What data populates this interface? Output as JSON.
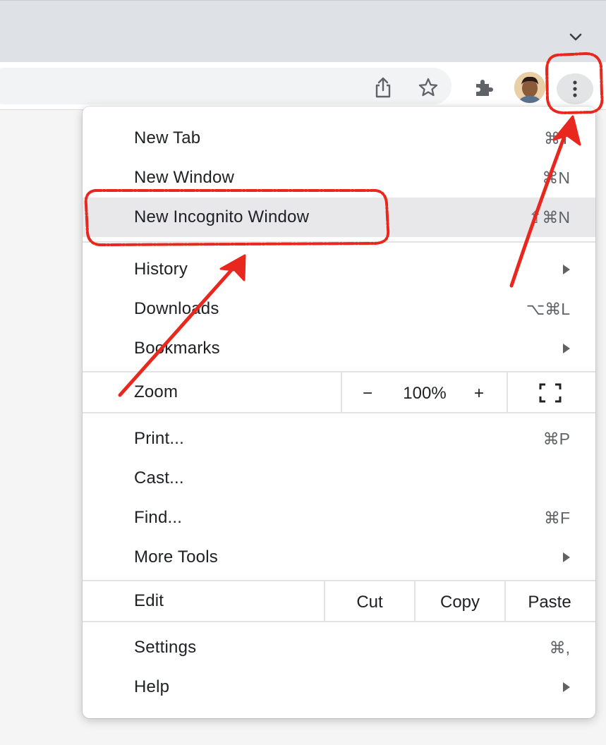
{
  "menu": {
    "items_top": [
      {
        "label": "New Tab",
        "accel": "⌘T"
      },
      {
        "label": "New Window",
        "accel": "⌘N"
      },
      {
        "label": "New Incognito Window",
        "accel": "⇧⌘N"
      }
    ],
    "items_nav": [
      {
        "label": "History",
        "submenu": true
      },
      {
        "label": "Downloads",
        "accel": "⌥⌘L"
      },
      {
        "label": "Bookmarks",
        "submenu": true
      }
    ],
    "zoom": {
      "label": "Zoom",
      "minus": "−",
      "value": "100%",
      "plus": "+"
    },
    "items_tools": [
      {
        "label": "Print...",
        "accel": "⌘P"
      },
      {
        "label": "Cast..."
      },
      {
        "label": "Find...",
        "accel": "⌘F"
      },
      {
        "label": "More Tools",
        "submenu": true
      }
    ],
    "edit": {
      "label": "Edit",
      "cut": "Cut",
      "copy": "Copy",
      "paste": "Paste"
    },
    "items_bottom": [
      {
        "label": "Settings",
        "accel": "⌘,"
      },
      {
        "label": "Help",
        "submenu": true
      }
    ]
  },
  "colors": {
    "annotation": "#e8281e",
    "highlight": "#e8e8ea"
  }
}
